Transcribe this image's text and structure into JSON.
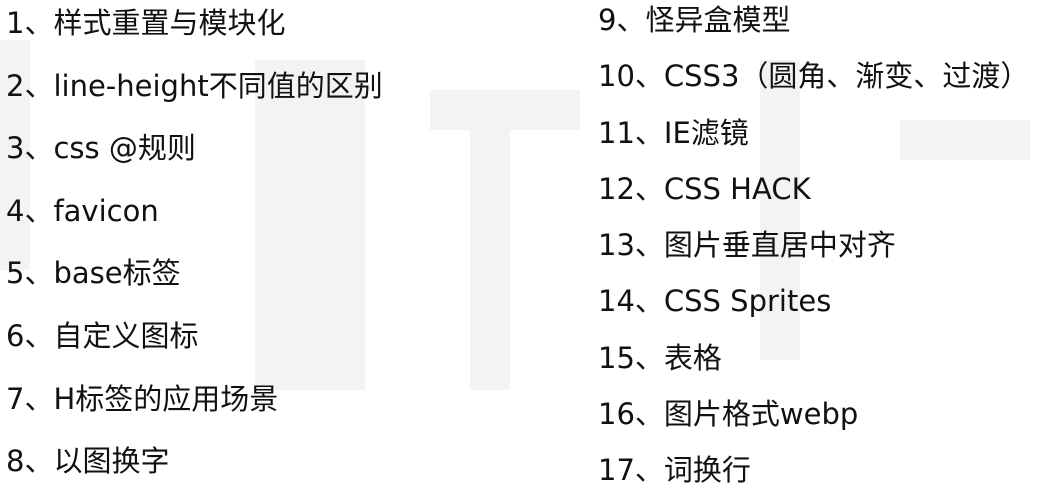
{
  "left_items": [
    "1、样式重置与模块化",
    "2、line-height不同值的区别",
    "3、css @规则",
    "4、favicon",
    "5、base标签",
    "6、自定义图标",
    "7、H标签的应用场景",
    "8、以图换字"
  ],
  "right_items": [
    "9、怪异盒模型",
    "10、CSS3（圆角、渐变、过渡）",
    "11、IE滤镜",
    "12、CSS HACK",
    "13、图片垂直居中对齐",
    "14、CSS Sprites",
    "15、表格",
    "16、图片格式webp",
    "17、词换行"
  ]
}
